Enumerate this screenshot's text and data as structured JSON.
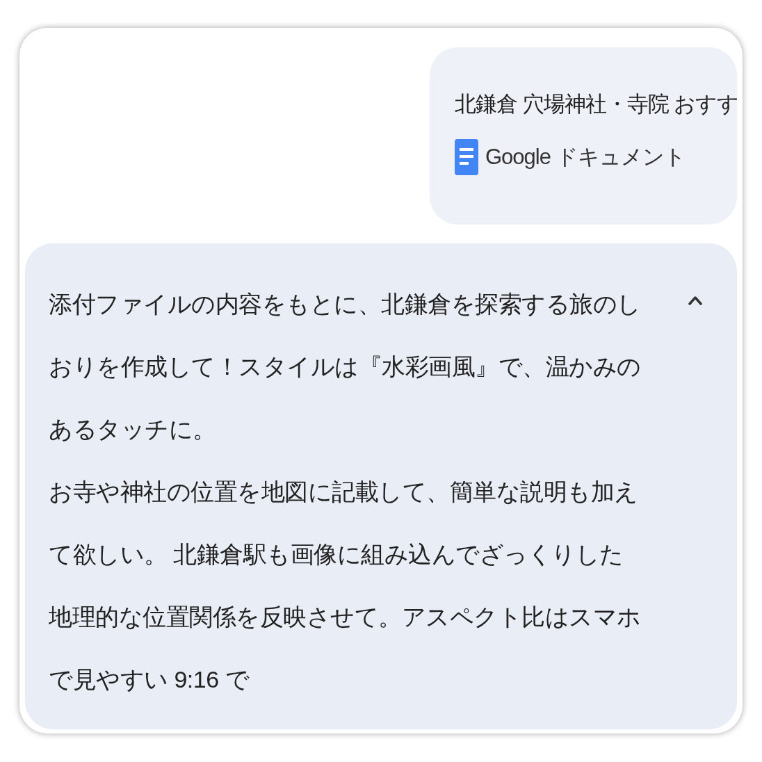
{
  "attachment": {
    "title": "北鎌倉 穴場神社・寺院 おすす",
    "source": "Google ドキュメント"
  },
  "message": {
    "expanded": true,
    "paragraphs": [
      "添付ファイルの内容をもとに、北鎌倉を探索する旅のしおりを作成して！スタイルは『水彩画風』で、温かみのあるタッチに。",
      "お寺や神社の位置を地図に記載して、簡単な説明も加えて欲しい。 北鎌倉駅も画像に組み込んでざっくりした地理的な位置関係を反映させて。アスペクト比はスマホで見やすい 9:16 で"
    ]
  }
}
